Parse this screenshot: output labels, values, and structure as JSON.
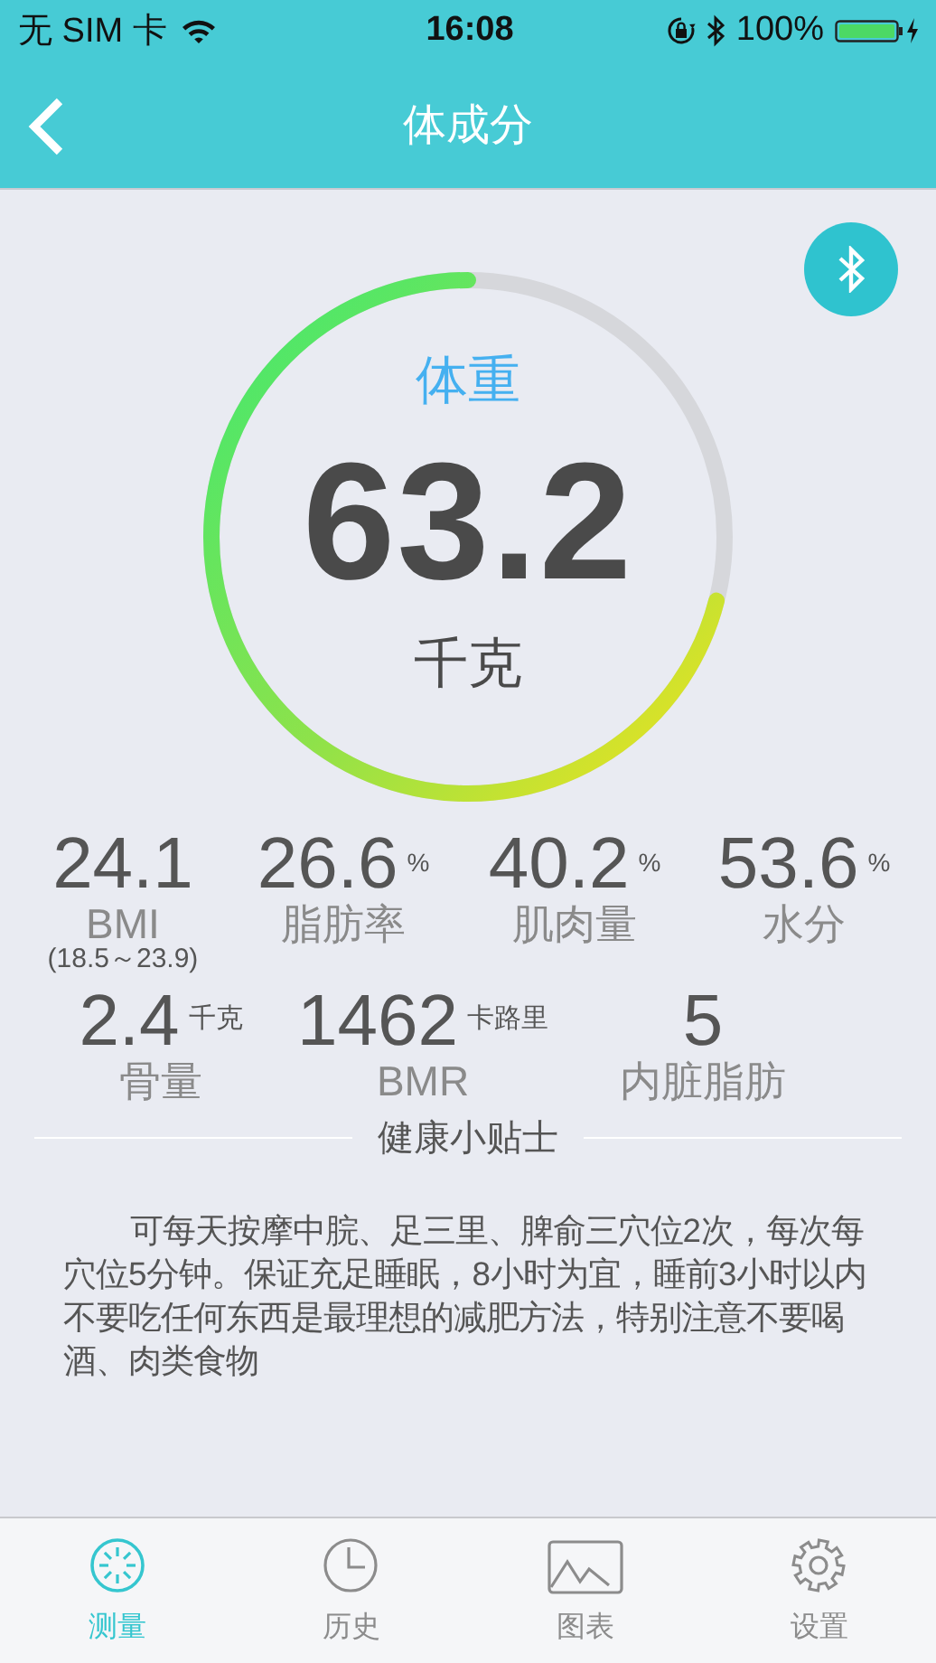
{
  "status_bar": {
    "carrier": "无 SIM 卡",
    "time": "16:08",
    "battery": "100%"
  },
  "nav": {
    "title": "体成分"
  },
  "gauge": {
    "title": "体重",
    "value": "63.2",
    "unit": "千克"
  },
  "stats": [
    {
      "value": "24.1",
      "label": "BMI",
      "note": "(18.5～23.9)"
    },
    {
      "value": "26.6",
      "unit": "%",
      "label": "脂肪率"
    },
    {
      "value": "40.2",
      "unit": "%",
      "label": "肌肉量"
    },
    {
      "value": "53.6",
      "unit": "%",
      "label": "水分"
    }
  ],
  "stats_2": [
    {
      "value": "2.4",
      "unit": "千克",
      "label": "骨量"
    },
    {
      "value": "1462",
      "unit": "卡路里",
      "label": "BMR"
    },
    {
      "value": "5",
      "label": "内脏脂肪"
    }
  ],
  "tips": {
    "title": "健康小贴士",
    "text": "可每天按摩中脘、足三里、脾俞三穴位2次，每次每穴位5分钟。保证充足睡眠，8小时为宜，睡前3小时以内不要吃任何东西是最理想的减肥方法，特别注意不要喝酒、肉类食物"
  },
  "tabs": [
    {
      "kind": "measure",
      "label": "测量",
      "selected": true
    },
    {
      "kind": "history",
      "label": "历史",
      "selected": false
    },
    {
      "kind": "chart",
      "label": "图表",
      "selected": false
    },
    {
      "kind": "settings",
      "label": "设置",
      "selected": false
    }
  ]
}
